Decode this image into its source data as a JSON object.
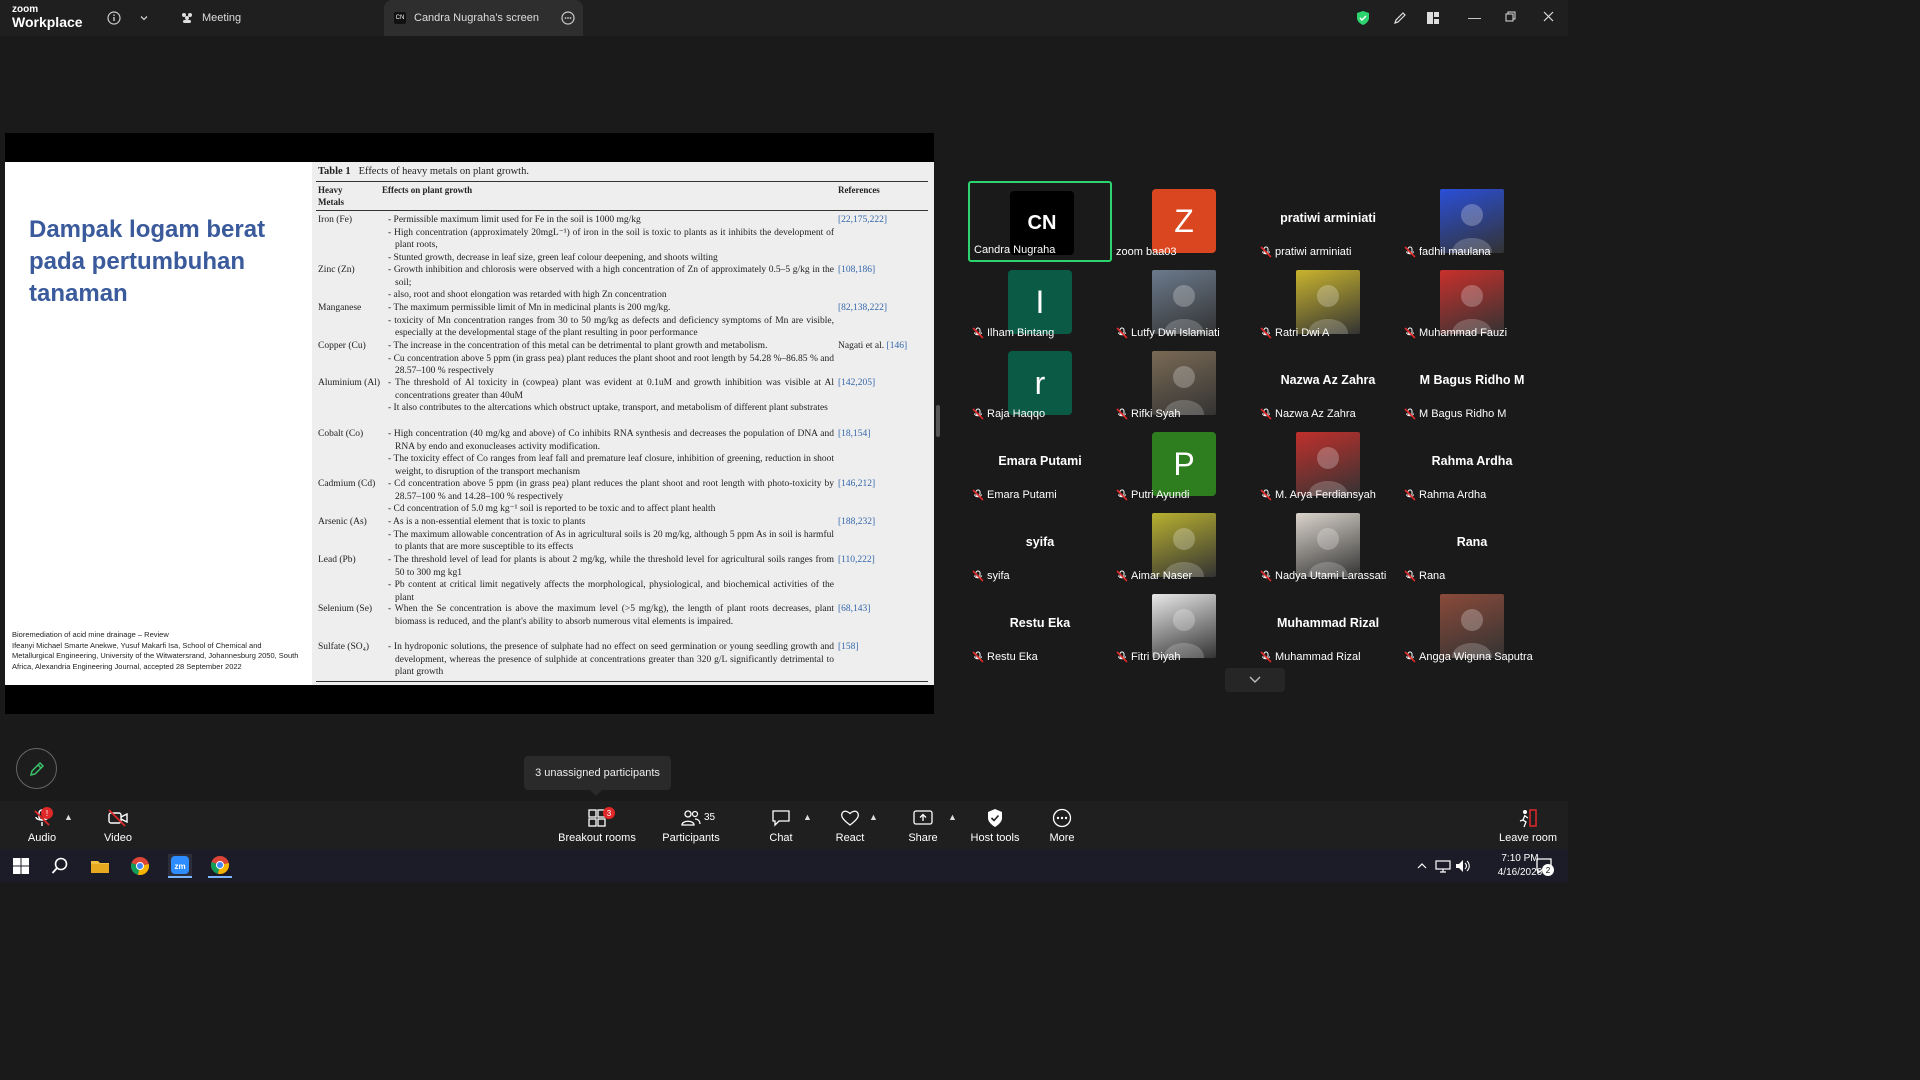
{
  "app": {
    "brand_small": "zoom",
    "brand_big": "Workplace",
    "tab_meeting": "Meeting",
    "tab_screen": "Candra Nugraha's screen",
    "tab_screen_icon_text": "CN"
  },
  "slide": {
    "title": "Dampak logam berat pada pertumbuhan tanaman",
    "caption_line1": "Bioremediation of acid mine drainage – Review",
    "caption_line2": "Ifeanyi Michael Smarte Anekwe, Yusuf Makarfi Isa, School of Chemical and Metallurgical Engineering, University of the Witwatersrand, Johannesburg 2050, South Africa, Alexandria Engineering Journal, accepted 28 September 2022"
  },
  "table": {
    "caption_label": "Table 1",
    "caption_text": "Effects of heavy metals on plant growth.",
    "headers": [
      "Heavy Metals",
      "Effects on plant growth",
      "References"
    ],
    "rows": [
      {
        "metal": "Iron (Fe)",
        "effects": [
          "- Permissible maximum limit used for Fe in the soil is 1000 mg/kg",
          "- High concentration (approximately 20mgL⁻¹) of iron in the soil is toxic to plants as it inhibits the development of plant roots,",
          "- Stunted growth, decrease in leaf size, green leaf colour deepening, and shoots wilting"
        ],
        "ref": "[22,175,222]",
        "ref_prefix": ""
      },
      {
        "metal": "Zinc (Zn)",
        "effects": [
          "- Growth inhibition and chlorosis were observed with a high concentration of Zn of approximately 0.5–5 g/kg in the soil;",
          "- also, root and shoot elongation was retarded with high Zn concentration"
        ],
        "ref": "[108,186]",
        "ref_prefix": ""
      },
      {
        "metal": "Manganese",
        "effects": [
          "- The maximum permissible limit of Mn in medicinal plants is 200 mg/kg.",
          "- toxicity of Mn concentration ranges from 30 to 50 mg/kg as defects and deficiency symptoms of Mn are visible, especially at the developmental stage of the plant resulting in poor performance"
        ],
        "ref": "[82,138,222]",
        "ref_prefix": ""
      },
      {
        "metal": "Copper (Cu)",
        "effects": [
          "- The increase in the concentration of this metal can be detrimental to plant growth and metabolism.",
          "- Cu concentration above 5 ppm (in grass pea) plant reduces the plant shoot and root length by 54.28 %–86.85 % and 28.57–100 % respectively"
        ],
        "ref": "[146]",
        "ref_prefix": "Nagati et al. "
      },
      {
        "metal": "Aluminium (Al)",
        "effects": [
          "- The threshold of Al toxicity in (cowpea) plant was evident at 0.1uM and growth inhibition was visible at Al concentrations greater than 40uM",
          "- It also contributes to the altercations which obstruct uptake, transport, and metabolism of different plant substrates"
        ],
        "ref": "[142,205]",
        "ref_prefix": ""
      },
      {
        "metal": "Cobalt (Co)",
        "effects": [
          "- High concentration (40 mg/kg and above) of Co inhibits RNA synthesis and decreases the population of DNA and RNA by endo and exonucleases activity modification.",
          "- The toxicity effect of Co ranges from leaf fall and premature leaf closure, inhibition of greening, reduction in shoot weight, to disruption of the transport mechanism"
        ],
        "ref": "[18,154]",
        "ref_prefix": ""
      },
      {
        "metal": "Cadmium (Cd)",
        "effects": [
          "- Cd concentration above 5 ppm (in grass pea) plant reduces the plant shoot and root length with photo-toxicity by 28.57–100 % and 14.28–100 % respectively",
          "- Cd concentration of 5.0 mg kg⁻¹ soil is reported to be toxic and to affect plant health"
        ],
        "ref": "[146,212]",
        "ref_prefix": ""
      },
      {
        "metal": "Arsenic (As)",
        "effects": [
          "- As is a non-essential element that is toxic to plants",
          "- The maximum allowable concentration of As in agricultural soils is 20 mg/kg, although 5 ppm As in soil is harmful to plants that are more susceptible to its effects"
        ],
        "ref": "[188,232]",
        "ref_prefix": ""
      },
      {
        "metal": "Lead (Pb)",
        "effects": [
          "- The threshold level of lead for plants is about 2 mg/kg, while the threshold level for agricultural soils ranges from 50 to 300 mg kg1",
          "- Pb content at critical limit negatively affects the morphological, physiological, and biochemical activities of the plant"
        ],
        "ref": "[110,222]",
        "ref_prefix": ""
      },
      {
        "metal": "Selenium (Se)",
        "effects": [
          "- When the Se concentration is above the maximum level (>5 mg/kg), the length of plant roots decreases, plant biomass is reduced, and the plant's ability to absorb numerous vital elements is impaired."
        ],
        "ref": "[68,143]",
        "ref_prefix": ""
      },
      {
        "metal": "Sulfate (SO₄)",
        "effects": [
          "- In hydroponic solutions, the presence of sulphate had no effect on seed germination or young seedling growth and development, whereas the presence of sulphide at concentrations greater than 320 g/L significantly detrimental to plant growth"
        ],
        "ref": "[158]",
        "ref_prefix": ""
      }
    ]
  },
  "participants": [
    {
      "name": "Candra Nugraha",
      "avatar_text": "CN",
      "avatar_color": "#000000",
      "kind": "letter",
      "muted": false
    },
    {
      "name": "zoom baa03",
      "avatar_text": "Z",
      "avatar_color": "#d9461f",
      "kind": "letter",
      "muted": false
    },
    {
      "name": "pratiwi arminiati",
      "big_name": "pratiwi arminiati",
      "kind": "name",
      "muted": true
    },
    {
      "name": "fadhil maulana",
      "kind": "photo",
      "photo_color": "#2a4fd8",
      "muted": true
    },
    {
      "name": "Ilham Bintang",
      "avatar_text": "I",
      "avatar_color": "#0b5a45",
      "kind": "letter",
      "muted": true
    },
    {
      "name": "Lutfy Dwi Islamiati",
      "kind": "photo",
      "photo_color": "#6b7a8c",
      "muted": true
    },
    {
      "name": "Ratri Dwi A",
      "kind": "photo",
      "photo_color": "#c9b42e",
      "muted": true
    },
    {
      "name": "Muhammad Fauzi",
      "kind": "photo",
      "photo_color": "#c8302c",
      "muted": true
    },
    {
      "name": "Raja Haqqo",
      "avatar_text": "r",
      "avatar_color": "#0b5a45",
      "kind": "letter",
      "muted": true
    },
    {
      "name": "Rifki Syah",
      "kind": "photo",
      "photo_color": "#7a6a55",
      "muted": true
    },
    {
      "name": "Nazwa Az Zahra",
      "big_name": "Nazwa Az Zahra",
      "kind": "name",
      "muted": true
    },
    {
      "name": "M Bagus Ridho M",
      "big_name": "M Bagus Ridho M",
      "kind": "name",
      "muted": true
    },
    {
      "name": "Emara Putami",
      "big_name": "Emara Putami",
      "kind": "name",
      "muted": true
    },
    {
      "name": "Putri Ayundi",
      "avatar_text": "P",
      "avatar_color": "#2e7d1f",
      "kind": "letter",
      "muted": true
    },
    {
      "name": "M. Arya Ferdiansyah",
      "kind": "photo",
      "photo_color": "#c0302c",
      "muted": true
    },
    {
      "name": "Rahma Ardha",
      "big_name": "Rahma Ardha",
      "kind": "name",
      "muted": true
    },
    {
      "name": "syifa",
      "big_name": "syifa",
      "kind": "name",
      "muted": true
    },
    {
      "name": "Aimar Naser",
      "kind": "photo",
      "photo_color": "#b8b030",
      "muted": true
    },
    {
      "name": "Nadya Utami Larassati",
      "kind": "photo",
      "photo_color": "#dad4cc",
      "muted": true
    },
    {
      "name": "Rana",
      "big_name": "Rana",
      "kind": "name",
      "muted": true
    },
    {
      "name": "Restu Eka",
      "big_name": "Restu Eka",
      "kind": "name",
      "muted": true
    },
    {
      "name": "Fitri Diyah",
      "kind": "photo",
      "photo_color": "#e8e8e8",
      "muted": true
    },
    {
      "name": "Muhammad Rizal",
      "big_name": "Muhammad Rizal",
      "kind": "name",
      "muted": true
    },
    {
      "name": "Angga Wiguna Saputra",
      "kind": "photo",
      "photo_color": "#8a4a3a",
      "muted": true
    }
  ],
  "tooltip": "3 unassigned participants",
  "toolbar": {
    "audio": "Audio",
    "video": "Video",
    "breakout": "Breakout rooms",
    "breakout_badge": "3",
    "participants": "Participants",
    "participants_count": "35",
    "chat": "Chat",
    "react": "React",
    "share": "Share",
    "host_tools": "Host tools",
    "more": "More",
    "leave": "Leave room",
    "audio_badge": "!"
  },
  "taskbar": {
    "time": "7:10 PM",
    "date": "4/16/2026",
    "notif_count": "2"
  },
  "colors": {
    "accent_green": "#2dd36f",
    "mute_red": "#e02828",
    "slide_title": "#3a5a9c",
    "ref_link": "#3366aa"
  }
}
